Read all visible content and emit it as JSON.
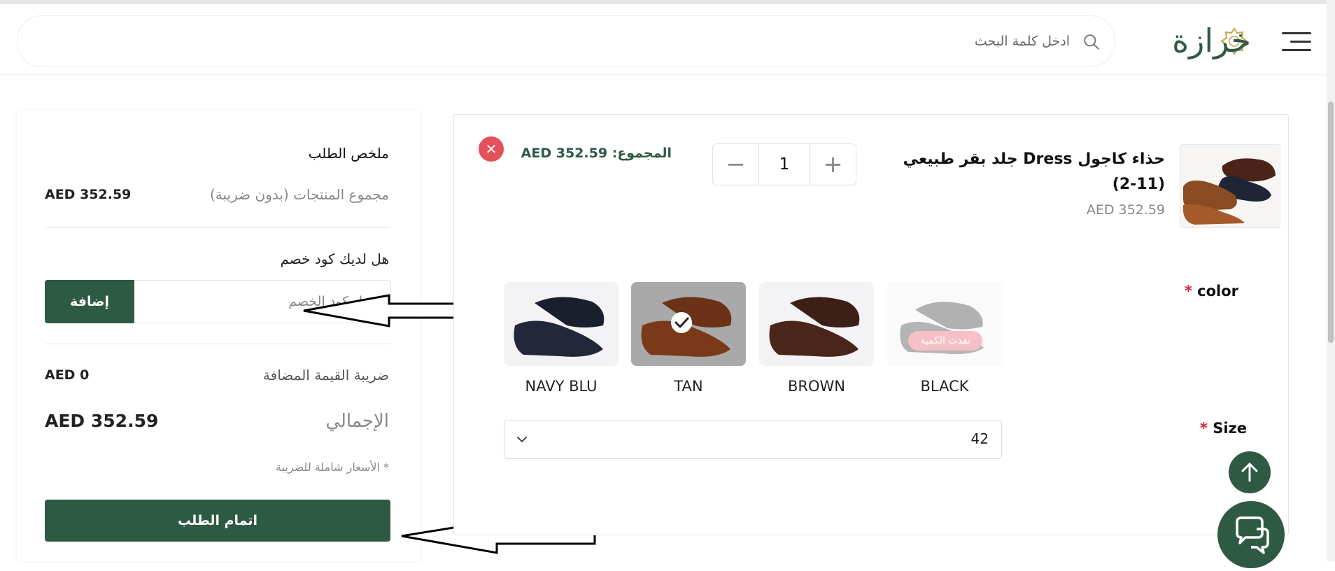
{
  "header": {
    "brand_name": "خرازة",
    "search_placeholder": "ادخل كلمة البحث"
  },
  "summary": {
    "title": "ملخص الطلب",
    "subtotal_label": "مجموع المنتجات (بدون ضريبة)",
    "subtotal_value": "AED 352.59",
    "discount_question": "هل لديك كود خصم",
    "discount_placeholder": "ادخل كود الخصم",
    "add_button": "إضافة",
    "vat_label": "ضريبة القيمة المضافة",
    "vat_value": "AED 0",
    "total_label": "الإجمالي",
    "total_value": "AED 352.59",
    "tax_note": "* الأسعار شاملة للضريبة",
    "checkout_button": "اتمام الطلب"
  },
  "product": {
    "name": "حذاء كاجول Dress جلد بقر طبيعي (11-2)",
    "price": "AED 352.59",
    "quantity": "1",
    "line_total_label": "المجموع:",
    "line_total_value": "AED 352.59",
    "remove_glyph": "✕",
    "color_label": "color",
    "size_label": "Size",
    "required_mark": "*",
    "colors": [
      {
        "name": "BLACK",
        "out_of_stock": true,
        "badge": "نفدت الكمية"
      },
      {
        "name": "BROWN",
        "out_of_stock": false
      },
      {
        "name": "TAN",
        "selected": true
      },
      {
        "name": "NAVY BLU",
        "out_of_stock": false
      }
    ],
    "size_value": "42"
  },
  "colors": {
    "brand_green": "#2e5a44",
    "remove_red": "#e4515a",
    "required_red": "#d9252f"
  },
  "icons": {
    "menu": "hamburger-menu-icon",
    "search": "search-icon",
    "scroll_top": "arrow-up-icon",
    "chat": "chat-icon"
  }
}
